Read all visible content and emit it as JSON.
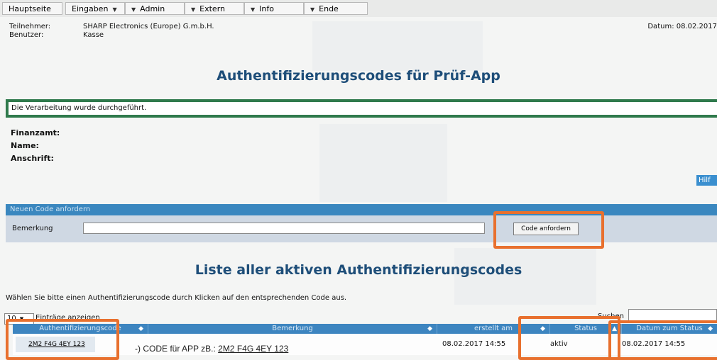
{
  "menu": [
    {
      "label": "Hauptseite",
      "has_dropdown": false
    },
    {
      "label": "Eingaben",
      "has_dropdown": true
    },
    {
      "label": "Admin",
      "has_dropdown": true
    },
    {
      "label": "Extern",
      "has_dropdown": true
    },
    {
      "label": "Info",
      "has_dropdown": true
    },
    {
      "label": "Ende",
      "has_dropdown": false
    }
  ],
  "header": {
    "teilnehmer_label": "Teilnehmer:",
    "teilnehmer_value": "SHARP Electronics (Europe) G.m.b.H.",
    "benutzer_label": "Benutzer:",
    "benutzer_value": "Kasse",
    "datum": "Datum: 08.02.2017"
  },
  "page_title": "Authentifizierungscodes für Prüf-App",
  "message": "Die Verarbeitung wurde durchgeführt.",
  "fields": {
    "finanzamt": "Finanzamt:",
    "name": "Name:",
    "anschrift": "Anschrift:"
  },
  "help_label": "Hilf",
  "new_code": {
    "section_title": "Neuen Code anfordern",
    "bemerkung_label": "Bemerkung",
    "bemerkung_value": "",
    "button_label": "Code anfordern"
  },
  "list": {
    "title": "Liste aller aktiven Authentifizierungscodes",
    "hint": "Wählen Sie bitte einen Authentifizierungscode durch Klicken auf den entsprechenden Code aus.",
    "page_length": "10",
    "page_length_suffix": "Einträge anzeigen",
    "search_label": "Suchen",
    "search_value": "",
    "columns": [
      {
        "label": "Authentifizierungscode",
        "sort": "◆"
      },
      {
        "label": "Bemerkung",
        "sort": "◆"
      },
      {
        "label": "erstellt am",
        "sort": "◆"
      },
      {
        "label": "Status",
        "sort": "▲"
      },
      {
        "label": "Datum zum Status",
        "sort": "◆"
      }
    ],
    "rows": [
      {
        "code": "2M2 F4G 4EY 123",
        "bemerkung": "",
        "erstellt_am": "08.02.2017 14:55",
        "status": "aktiv",
        "datum_status": "08.02.2017 14:55"
      }
    ]
  },
  "annotation": {
    "prefix": "-) CODE für APP zB.: ",
    "code": "2M2 F4G 4EY 123"
  },
  "colors": {
    "highlight": "#e8702e",
    "table_header": "#3d85c0",
    "title": "#1e4e79",
    "message_border": "#2f7a4c"
  }
}
